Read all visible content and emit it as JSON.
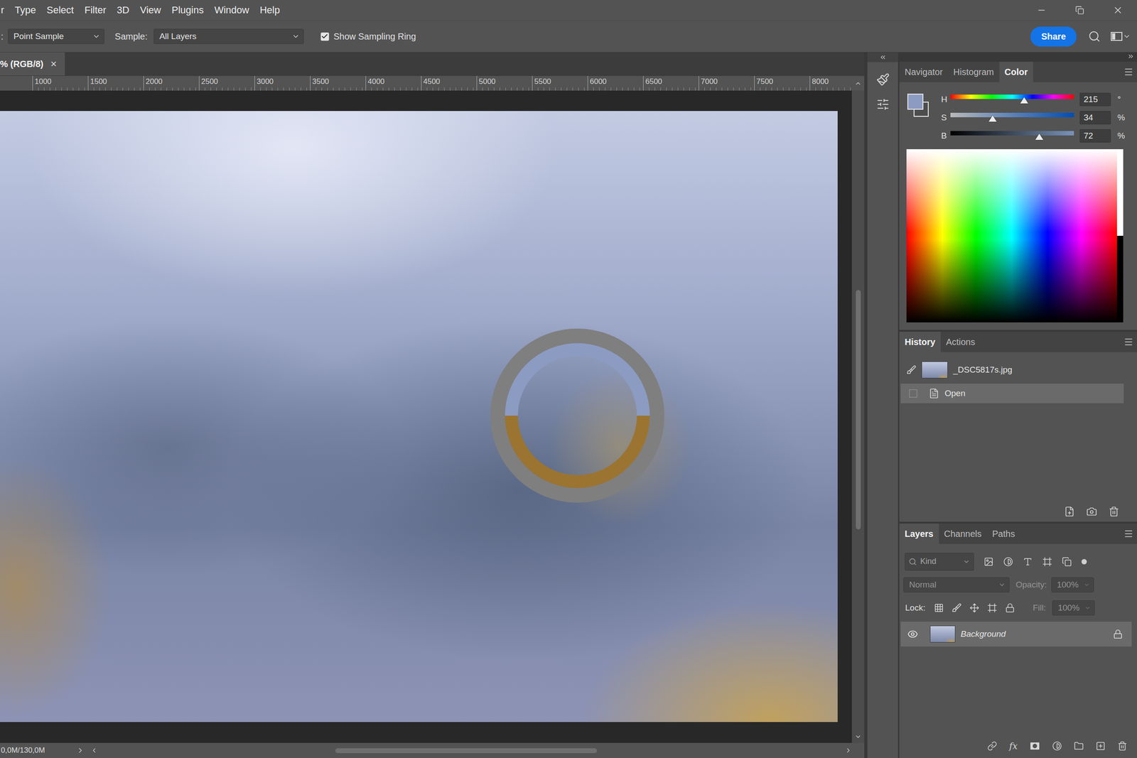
{
  "menu": [
    "r",
    "Type",
    "Select",
    "Filter",
    "3D",
    "View",
    "Plugins",
    "Window",
    "Help"
  ],
  "options_bar": {
    "lead": ":",
    "sample_size": "Point Sample",
    "sample_label": "Sample:",
    "sample": "All Layers",
    "sampling_ring": {
      "label": "Show Sampling Ring",
      "checked": true
    },
    "share": "Share"
  },
  "document": {
    "tab": "% (RGB/8)",
    "close": "×"
  },
  "ruler": [
    "1000",
    "1500",
    "2000",
    "2500",
    "3000",
    "3500",
    "4000",
    "4500",
    "5000",
    "5500",
    "6000",
    "6500",
    "7000",
    "7500",
    "8000"
  ],
  "sampling_ring": [
    {
      "part": "new",
      "color": "#8c9bc2"
    },
    {
      "part": "current",
      "color": "#9b7431"
    }
  ],
  "status_bar": {
    "doc_size": "0,0M/130,0M"
  },
  "color_panel": {
    "tabs": [
      {
        "label": "Navigator",
        "selected": false
      },
      {
        "label": "Histogram",
        "selected": false
      },
      {
        "label": "Color",
        "selected": true
      }
    ],
    "foreground": "#8c9bc2",
    "background": "#4d4d4d",
    "sliders": [
      {
        "label": "H",
        "value": "215",
        "unit": "°",
        "level": 0.597
      },
      {
        "label": "S",
        "value": "34",
        "unit": "%",
        "level": 0.34
      },
      {
        "label": "B",
        "value": "72",
        "unit": "%",
        "level": 0.72
      }
    ]
  },
  "history_panel": {
    "tabs": [
      {
        "label": "History",
        "selected": true
      },
      {
        "label": "Actions",
        "selected": false
      }
    ],
    "snapshot": "_DSC5817s.jpg",
    "states": [
      {
        "label": "Open",
        "selected": true
      }
    ]
  },
  "layers_panel": {
    "tabs": [
      {
        "label": "Layers",
        "selected": true
      },
      {
        "label": "Channels",
        "selected": false
      },
      {
        "label": "Paths",
        "selected": false
      }
    ],
    "filter": "Kind",
    "blend_mode": "Normal",
    "opacity_label": "Opacity:",
    "opacity": "100%",
    "lock_label": "Lock:",
    "fill_label": "Fill:",
    "fill": "100%",
    "options_disabled": true,
    "fx": "fx",
    "layers": [
      {
        "name": "Background",
        "visible": true,
        "locked": true,
        "selected": true
      }
    ]
  }
}
